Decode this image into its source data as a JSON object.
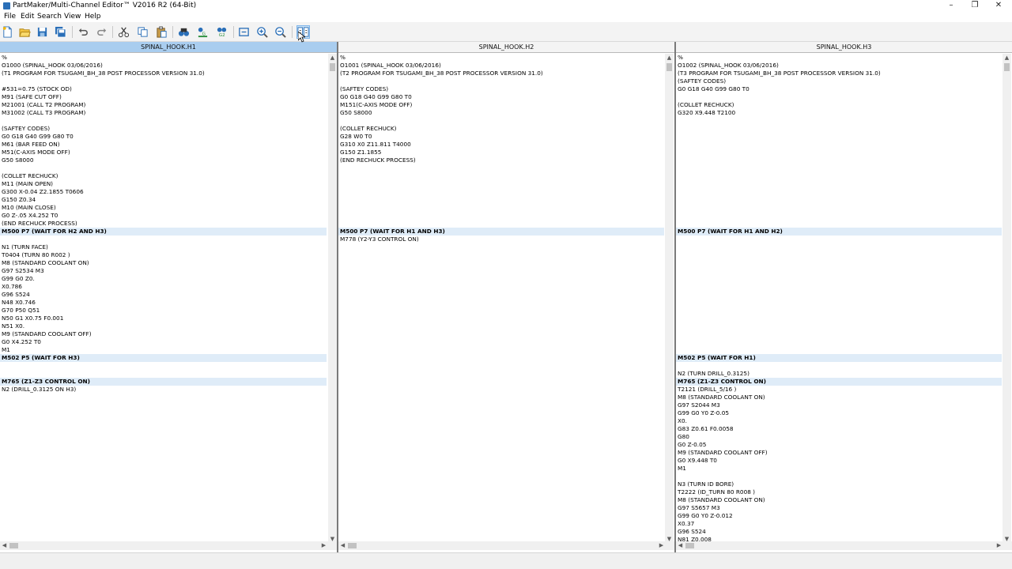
{
  "window": {
    "title": "PartMaker/Multi-Channel Editor™ V2016 R2 (64-Bit)"
  },
  "menu": [
    "File",
    "Edit",
    "Search",
    "View",
    "Help"
  ],
  "toolbar": {
    "icons": [
      "new-file-icon",
      "open-folder-icon",
      "save-icon",
      "save-all-icon",
      "undo-icon",
      "redo-icon",
      "cut-icon",
      "copy-icon",
      "paste-icon",
      "find-icon",
      "find-sync-icon",
      "find-channel-icon",
      "zoom-fit-icon",
      "zoom-in-icon",
      "zoom-out-icon",
      "sync-panes-icon"
    ]
  },
  "colors": {
    "active_header": "#a9cdef",
    "sync_highlight": "#dfecf8"
  },
  "panes": [
    {
      "header": "SPINAL_HOOK.H1",
      "active": true,
      "lines": [
        {
          "t": "%"
        },
        {
          "t": "O1000 (SPINAL_HOOK 03/06/2016)"
        },
        {
          "t": "(T1 PROGRAM FOR TSUGAMI_BH_38 POST PROCESSOR VERSION 31.0)"
        },
        {
          "t": ""
        },
        {
          "t": "#531=0.75 (STOCK OD)"
        },
        {
          "t": "M91 (SAFE CUT OFF)"
        },
        {
          "t": "M21001 (CALL T2 PROGRAM)"
        },
        {
          "t": "M31002 (CALL T3 PROGRAM)"
        },
        {
          "t": ""
        },
        {
          "t": "(SAFTEY CODES)"
        },
        {
          "t": "G0 G18 G40 G99 G80 T0"
        },
        {
          "t": "M61 (BAR FEED ON)"
        },
        {
          "t": "M51(C-AXIS MODE OFF)"
        },
        {
          "t": "G50 S8000"
        },
        {
          "t": ""
        },
        {
          "t": "(COLLET RECHUCK)"
        },
        {
          "t": "M11 (MAIN OPEN)"
        },
        {
          "t": "G300 X-0.04 Z2.1855 T0606"
        },
        {
          "t": "G150 Z0.34"
        },
        {
          "t": "M10 (MAIN CLOSE)"
        },
        {
          "t": "G0 Z-.05 X4.252 T0"
        },
        {
          "t": "(END RECHUCK PROCESS)"
        },
        {
          "t": "M500 P7 (WAIT FOR H2 AND H3)",
          "sync": true
        },
        {
          "t": ""
        },
        {
          "t": "N1 (TURN FACE)"
        },
        {
          "t": "T0404 (TURN 80 R002 )"
        },
        {
          "t": "M8 (STANDARD COOLANT ON)"
        },
        {
          "t": "G97 S2534 M3"
        },
        {
          "t": "G99 G0 Z0."
        },
        {
          "t": "X0.786"
        },
        {
          "t": "G96 S524"
        },
        {
          "t": "N48 X0.746"
        },
        {
          "t": "G70 P50 Q51"
        },
        {
          "t": "N50 G1 X0.75 F0.001"
        },
        {
          "t": "N51 X0."
        },
        {
          "t": "M9 (STANDARD COOLANT OFF)"
        },
        {
          "t": "G0 X4.252 T0"
        },
        {
          "t": "M1"
        },
        {
          "t": "M502 P5 (WAIT FOR H3)",
          "sync": true
        },
        {
          "t": ""
        },
        {
          "t": ""
        },
        {
          "t": "M765 (Z1-Z3 CONTROL ON)",
          "sync": true
        },
        {
          "t": "N2 (DRILL_0.3125 ON H3)"
        }
      ]
    },
    {
      "header": "SPINAL_HOOK.H2",
      "active": false,
      "lines": [
        {
          "t": "%"
        },
        {
          "t": "O1001 (SPINAL_HOOK 03/06/2016)"
        },
        {
          "t": "(T2 PROGRAM FOR TSUGAMI_BH_38 POST PROCESSOR VERSION 31.0)"
        },
        {
          "t": ""
        },
        {
          "t": "(SAFTEY CODES)"
        },
        {
          "t": "G0 G18 G40 G99 G80 T0"
        },
        {
          "t": "M151(C-AXIS MODE OFF)"
        },
        {
          "t": "G50 S8000"
        },
        {
          "t": ""
        },
        {
          "t": "(COLLET RECHUCK)"
        },
        {
          "t": "G28 W0 T0"
        },
        {
          "t": "G310 X0 Z11.811 T4000"
        },
        {
          "t": "G150 Z1.1855"
        },
        {
          "t": "(END RECHUCK PROCESS)"
        },
        {
          "t": ""
        },
        {
          "t": ""
        },
        {
          "t": ""
        },
        {
          "t": ""
        },
        {
          "t": ""
        },
        {
          "t": ""
        },
        {
          "t": ""
        },
        {
          "t": ""
        },
        {
          "t": "M500 P7 (WAIT FOR H1 AND H3)",
          "sync": true
        },
        {
          "t": "M778 (Y2-Y3 CONTROL ON)"
        }
      ]
    },
    {
      "header": "SPINAL_HOOK.H3",
      "active": false,
      "lines": [
        {
          "t": "%"
        },
        {
          "t": "O1002 (SPINAL_HOOK 03/06/2016)"
        },
        {
          "t": "(T3 PROGRAM FOR TSUGAMI_BH_38 POST PROCESSOR VERSION 31.0)"
        },
        {
          "t": "(SAFTEY CODES)"
        },
        {
          "t": "G0 G18 G40 G99 G80 T0"
        },
        {
          "t": ""
        },
        {
          "t": "(COLLET RECHUCK)"
        },
        {
          "t": "G320 X9.448 T2100"
        },
        {
          "t": ""
        },
        {
          "t": ""
        },
        {
          "t": ""
        },
        {
          "t": ""
        },
        {
          "t": ""
        },
        {
          "t": ""
        },
        {
          "t": ""
        },
        {
          "t": ""
        },
        {
          "t": ""
        },
        {
          "t": ""
        },
        {
          "t": ""
        },
        {
          "t": ""
        },
        {
          "t": ""
        },
        {
          "t": ""
        },
        {
          "t": "M500 P7 (WAIT FOR H1 AND H2)",
          "sync": true
        },
        {
          "t": ""
        },
        {
          "t": ""
        },
        {
          "t": ""
        },
        {
          "t": ""
        },
        {
          "t": ""
        },
        {
          "t": ""
        },
        {
          "t": ""
        },
        {
          "t": ""
        },
        {
          "t": ""
        },
        {
          "t": ""
        },
        {
          "t": ""
        },
        {
          "t": ""
        },
        {
          "t": ""
        },
        {
          "t": ""
        },
        {
          "t": ""
        },
        {
          "t": "M502 P5 (WAIT FOR H1)",
          "sync": true
        },
        {
          "t": ""
        },
        {
          "t": "N2 (TURN DRILL_0.3125)"
        },
        {
          "t": "M765 (Z1-Z3 CONTROL ON)",
          "sync": true
        },
        {
          "t": "T2121 (DRILL_5/16 )"
        },
        {
          "t": "M8 (STANDARD COOLANT ON)"
        },
        {
          "t": "G97 S2044 M3"
        },
        {
          "t": "G99 G0 Y0 Z-0.05"
        },
        {
          "t": "X0."
        },
        {
          "t": "G83 Z0.61 F0.0058"
        },
        {
          "t": "G80"
        },
        {
          "t": "G0 Z-0.05"
        },
        {
          "t": "M9 (STANDARD COOLANT OFF)"
        },
        {
          "t": "G0 X9.448 T0"
        },
        {
          "t": "M1"
        },
        {
          "t": ""
        },
        {
          "t": "N3 (TURN ID BORE)"
        },
        {
          "t": "T2222 (ID_TURN 80 R008 )"
        },
        {
          "t": "M8 (STANDARD COOLANT ON)"
        },
        {
          "t": "G97 S5657 M3"
        },
        {
          "t": "G99 G0 Y0 Z-0.012"
        },
        {
          "t": "X0.37"
        },
        {
          "t": "G96 S524"
        },
        {
          "t": "N81 Z0.008"
        }
      ]
    }
  ]
}
